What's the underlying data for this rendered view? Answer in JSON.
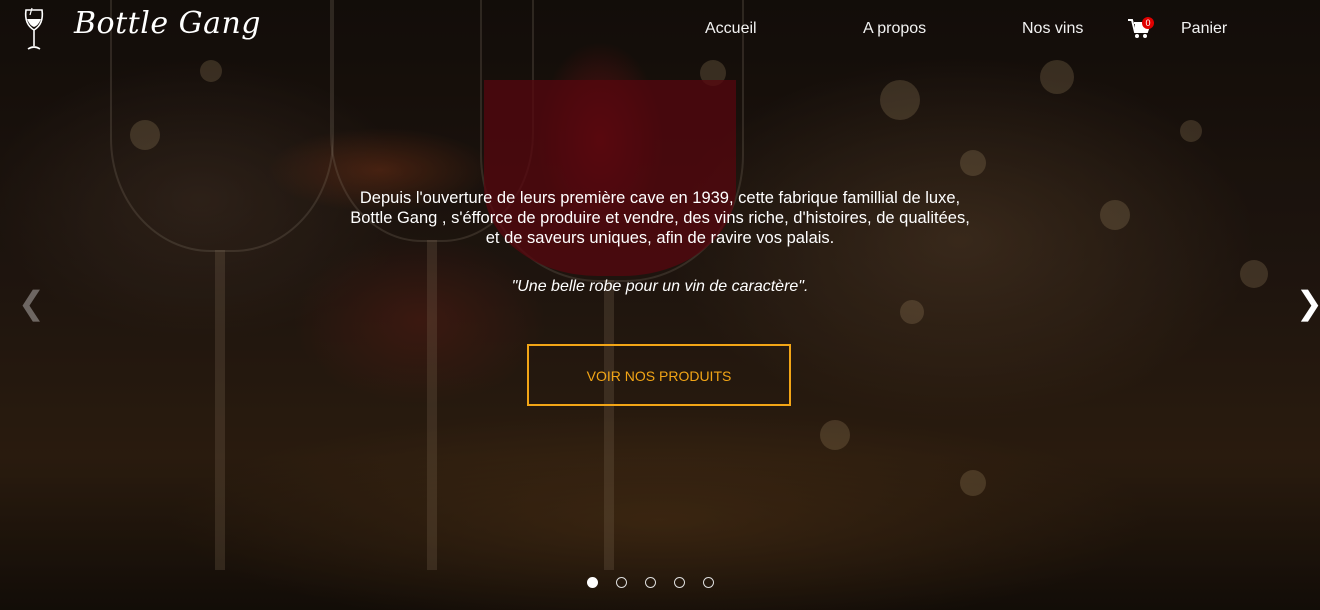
{
  "brand": {
    "name": "Bottle Gang"
  },
  "icons": {
    "logo": "wine-glass-icon",
    "cart": "cart-icon",
    "prev": "chevron-left-icon",
    "next": "chevron-right-icon"
  },
  "nav": {
    "items": [
      {
        "label": "Accueil"
      },
      {
        "label": "A propos"
      },
      {
        "label": "Nos vins"
      },
      {
        "label": "Panier"
      }
    ],
    "cart_count": "0"
  },
  "hero": {
    "intro_line1": "Depuis l'ouverture de leurs première cave en 1939, cette fabrique famillial de luxe,",
    "intro_line2": "Bottle Gang , s'éfforce de produire et vendre, des vins riche, d'histoires, de qualitées,",
    "intro_line3": "et de saveurs uniques, afin de ravire vos palais.",
    "tagline": "\"Une belle robe pour un vin de caractère\".",
    "cta_label": "VOIR NOS PRODUITS",
    "slide_count": 5,
    "active_slide": 1
  },
  "colors": {
    "accent": "#f2a516",
    "badge": "#e00000",
    "text": "#ffffff"
  }
}
